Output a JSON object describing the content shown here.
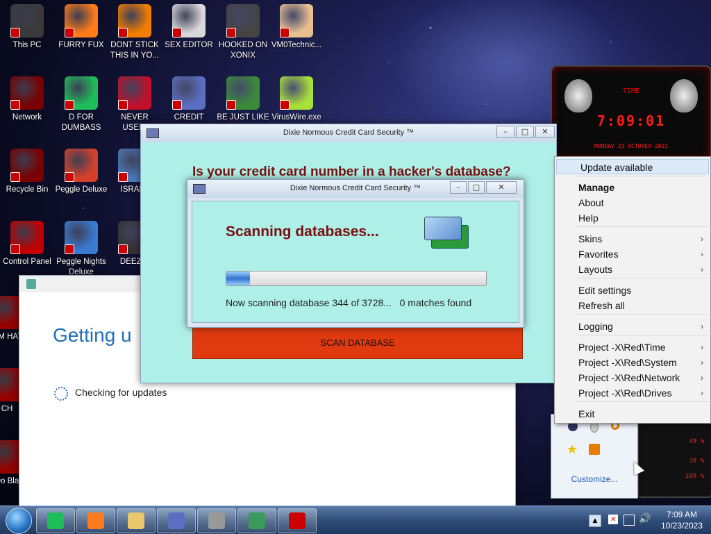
{
  "desktop_icons": [
    {
      "label": "This PC",
      "icon": "this-pc-icon"
    },
    {
      "label": "FURRY FUX",
      "icon": "firefox-icon"
    },
    {
      "label": "DONT STICK THIS IN YO...",
      "icon": "vlc-cone-icon"
    },
    {
      "label": "SEX EDITOR",
      "icon": "hxd-editor-icon"
    },
    {
      "label": "HOOKED ON XONIX",
      "icon": "xonix-game-icon"
    },
    {
      "label": "VM0Technic...",
      "icon": "doctor-avatar-icon"
    },
    {
      "label": "Network",
      "icon": "network-icon"
    },
    {
      "label": "D FOR DUMBASS",
      "icon": "green-chat-icon"
    },
    {
      "label": "NEVER USED!",
      "icon": "devcpp-icon"
    },
    {
      "label": "CREDIT CARD",
      "icon": "credit-card-icon"
    },
    {
      "label": "BE JUST LIKE",
      "icon": "santa-elf-icon"
    },
    {
      "label": "VirusWire.exe",
      "icon": "lime-icon"
    },
    {
      "label": "Recycle Bin",
      "icon": "recycle-bin-icon"
    },
    {
      "label": "Peggle Deluxe",
      "icon": "peggle-icon"
    },
    {
      "label": "ISRAEL",
      "icon": "network-share-icon"
    },
    {
      "label": "Control Panel",
      "icon": "control-panel-icon"
    },
    {
      "label": "Peggle Nights Deluxe",
      "icon": "peggle-nights-icon"
    },
    {
      "label": "DEEZ N",
      "icon": "folder-stack-icon"
    },
    {
      "label": "COM HATE",
      "icon": "red-app-icon"
    },
    {
      "label": "CH",
      "icon": "red-app-icon"
    },
    {
      "label": "Do Bla",
      "icon": "red-app-icon"
    }
  ],
  "back_window": {
    "title": "Dixie Normous Credit Card Security ™",
    "heading": "Is your credit card number in a hacker's database?",
    "scan_button": "SCAN DATABASE"
  },
  "dialog": {
    "title": "Dixie Normous Credit Card Security ™",
    "heading": "Scanning databases...",
    "progress_fraction": 0.09,
    "status": "Now scanning database 344 of 3728...   0 matches found"
  },
  "update_window": {
    "heading": "Getting u",
    "status": "Checking for updates"
  },
  "clock_widget": {
    "label": "TIME",
    "time": "7:09:01",
    "date": "MONDAY 23 OCTOBER 2023"
  },
  "context_menu": {
    "items": [
      {
        "label": "Update available",
        "bold": false,
        "arrow": false,
        "highlight": true
      },
      {
        "label": "Manage",
        "bold": true,
        "arrow": false
      },
      {
        "label": "About",
        "bold": false,
        "arrow": false
      },
      {
        "label": "Help",
        "bold": false,
        "arrow": false
      },
      {
        "label": "Skins",
        "bold": false,
        "arrow": true
      },
      {
        "label": "Favorites",
        "bold": false,
        "arrow": true
      },
      {
        "label": "Layouts",
        "bold": false,
        "arrow": true
      },
      {
        "label": "Edit settings",
        "bold": false,
        "arrow": false
      },
      {
        "label": "Refresh all",
        "bold": false,
        "arrow": false
      },
      {
        "label": "Logging",
        "bold": false,
        "arrow": true
      },
      {
        "label": "Project -X\\Red\\Time",
        "bold": false,
        "arrow": true
      },
      {
        "label": "Project -X\\Red\\System",
        "bold": false,
        "arrow": true
      },
      {
        "label": "Project -X\\Red\\Network",
        "bold": false,
        "arrow": true
      },
      {
        "label": "Project -X\\Red\\Drives",
        "bold": false,
        "arrow": true
      },
      {
        "label": "Exit",
        "bold": false,
        "arrow": false
      }
    ]
  },
  "tray_popup": {
    "customize": "Customize...",
    "icons": [
      "rainmeter-icon",
      "drop-icon",
      "magnifier-icon",
      "star-icon",
      "java-icon"
    ]
  },
  "widget_readouts": [
    "49 %",
    "18 %",
    "109 %"
  ],
  "taskbar": {
    "apps": [
      "green-chat-icon",
      "firefox-icon",
      "explorer-icon",
      "credit-card-icon",
      "firewall-icon",
      "setup-icon",
      "game-icon"
    ],
    "time": "7:09 AM",
    "date": "10/23/2023"
  },
  "colors": {
    "accent_red": "#e03a10",
    "dialog_bg": "#aef0e8",
    "heading_red": "#7a1010"
  }
}
